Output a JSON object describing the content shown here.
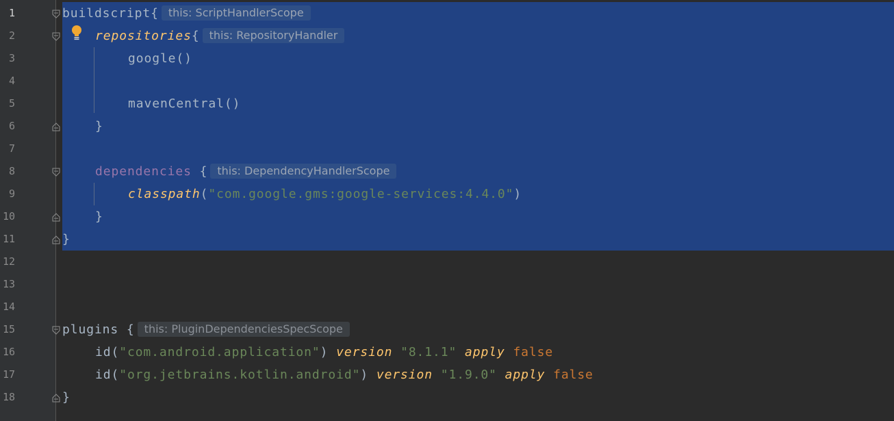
{
  "editor": {
    "current_line": "1",
    "lines": [
      {
        "n": "1",
        "t": {
          "a": "buildscript",
          "b": "{",
          "hint": "this: ScriptHandlerScope"
        }
      },
      {
        "n": "2",
        "t": {
          "a": "repositories",
          "b": "{",
          "hint": "this: RepositoryHandler"
        }
      },
      {
        "n": "3",
        "t": {
          "a": "google()"
        }
      },
      {
        "n": "4",
        "t": {}
      },
      {
        "n": "5",
        "t": {
          "a": "mavenCentral()"
        }
      },
      {
        "n": "6",
        "t": {
          "a": "}"
        }
      },
      {
        "n": "7",
        "t": {}
      },
      {
        "n": "8",
        "t": {
          "a": "dependencies",
          "b": "{",
          "hint": "this: DependencyHandlerScope"
        }
      },
      {
        "n": "9",
        "t": {
          "a": "classpath",
          "p1": "(",
          "s": "\"com.google.gms:google-services:4.4.0\"",
          "p2": ")"
        }
      },
      {
        "n": "10",
        "t": {
          "a": "}"
        }
      },
      {
        "n": "11",
        "t": {
          "a": "}"
        }
      },
      {
        "n": "12",
        "t": {}
      },
      {
        "n": "13",
        "t": {}
      },
      {
        "n": "14",
        "t": {}
      },
      {
        "n": "15",
        "t": {
          "a": "plugins",
          "b": "{",
          "hint": "this: PluginDependenciesSpecScope"
        }
      },
      {
        "n": "16",
        "t": {
          "a": "id(",
          "s": "\"com.android.application\"",
          "p": ")",
          "v": "version",
          "vs": "\"8.1.1\"",
          "ap": "apply",
          "f": "false"
        }
      },
      {
        "n": "17",
        "t": {
          "a": "id(",
          "s": "\"org.jetbrains.kotlin.android\"",
          "p": ")",
          "v": "version",
          "vs": "\"1.9.0\"",
          "ap": "apply",
          "f": "false"
        }
      },
      {
        "n": "18",
        "t": {
          "a": "}"
        }
      }
    ]
  },
  "colors": {
    "background": "#2b2b2b",
    "gutter": "#313335",
    "selection": "#214283",
    "keyword_function": "#ffc66d",
    "keyword_purple": "#9876aa",
    "string": "#6a8759",
    "keyword_orange": "#cc7832",
    "text": "#a9b7c6"
  },
  "icons": {
    "fold": "fold-marker-icon",
    "bulb": "lightbulb-icon"
  }
}
